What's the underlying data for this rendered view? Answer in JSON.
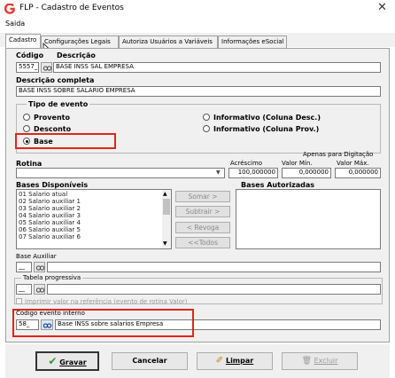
{
  "window": {
    "title": "FLP - Cadastro de Eventos"
  },
  "menu": {
    "items": [
      "Saida"
    ]
  },
  "tabs": [
    "Cadastro",
    "Configurações Legais",
    "Autoriza Usuários a Variáveis",
    "Informações eSocial"
  ],
  "form": {
    "codigo_label": "Código",
    "descricao_label": "Descrição",
    "codigo_value": "5557_",
    "descricao_value": "BASE INSS SAL EMPRESA",
    "descricao_completa_label": "Descrição completa",
    "descricao_completa_value": "BASE INSS SOBRE SALARIO EMPRESA",
    "tipo_evento": {
      "label": "Tipo de evento",
      "options": [
        "Provento",
        "Desconto",
        "Base",
        "Informativo (Coluna Desc.)",
        "Informativo (Coluna Prov.)"
      ],
      "selected": "Base"
    },
    "rotina_label": "Rotina",
    "digitacao_label": "Apenas para Digitação",
    "acrescimo_label": "Acréscimo",
    "valor_min_label": "Valor Mín.",
    "valor_max_label": "Valor Máx.",
    "acrescimo_value": "100,000000",
    "valor_min_value": "0,000000",
    "valor_max_value": "0,000000",
    "bases_disponiveis_label": "Bases Disponíveis",
    "bases_disponiveis": [
      "01 Salario atual",
      "02 Salario auxiliar 1",
      "03 Salario auxiliar 2",
      "04 Salario auxiliar 3",
      "05 Salario auxiliar 4",
      "06 Salario auxiliar 5",
      "07 Salario auxiliar 6"
    ],
    "bases_autorizadas_label": "Bases Autorizadas",
    "buttons": {
      "somar": "Somar >",
      "subtrair": "Subtrair >",
      "revoga": "< Revoga",
      "todos": "<<Todos"
    },
    "base_auxiliar_label": "Base Auxiliar",
    "base_auxiliar_value": "__",
    "tabela_progressiva_label": "Tabela progressiva",
    "tabela_progressiva_value": "__",
    "imprimir_label": "Imprimir valor na referência (evento de rotina Valor)",
    "codigo_evento_interno_label": "Código evento interno",
    "codigo_evento_interno_value": "58_",
    "codigo_evento_interno_desc": "Base INSS sobre salarios Empresa"
  },
  "footer": {
    "gravar": "Gravar",
    "cancelar": "Cancelar",
    "limpar": "Limpar",
    "excluir": "Excluir"
  },
  "colors": {
    "highlight": "#e0261a",
    "app_icon": "#e53935"
  }
}
